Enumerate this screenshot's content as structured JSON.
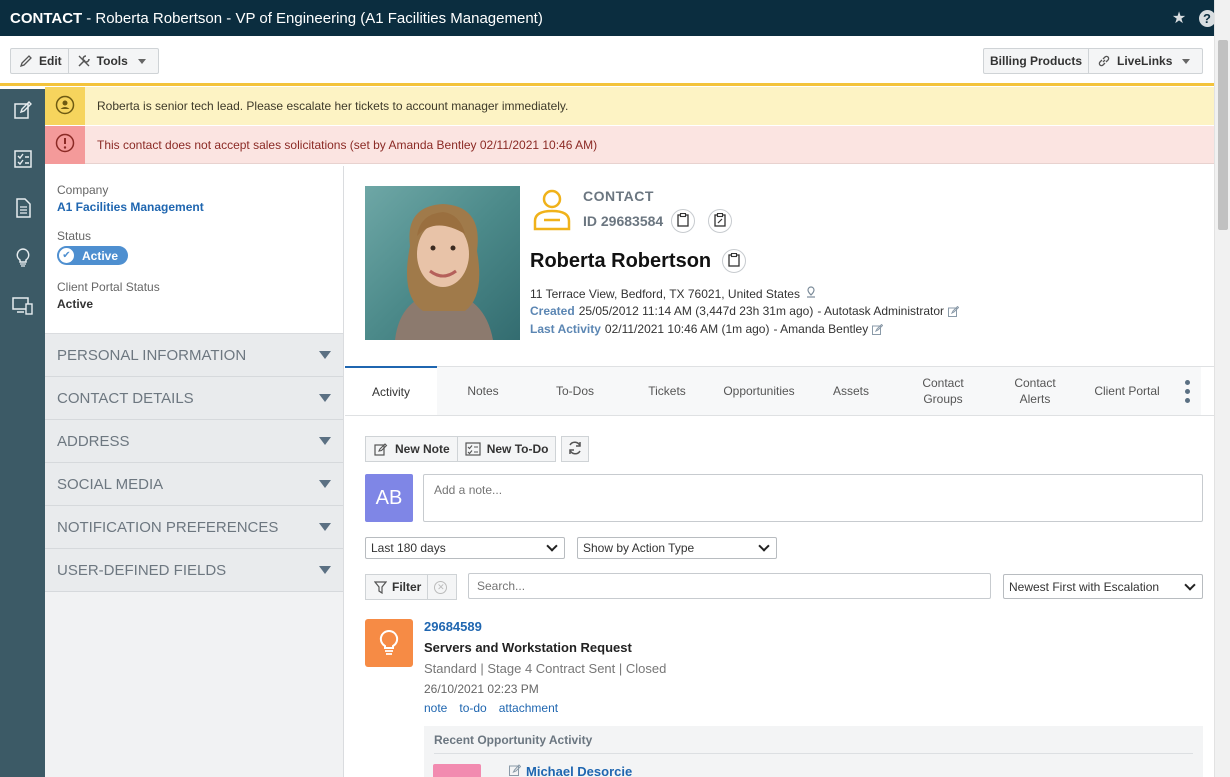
{
  "window": {
    "title_strong": "CONTACT",
    "title_rest": "- Roberta Robertson - VP of Engineering (A1 Facilities Management)"
  },
  "toolbar": {
    "edit_label": "Edit",
    "tools_label": "Tools",
    "billing_label": "Billing Products",
    "livelinks_label": "LiveLinks"
  },
  "alerts": {
    "yellow": "Roberta is senior tech lead. Please escalate her tickets to account manager immediately.",
    "red": "This contact does not accept sales solicitations (set by Amanda Bentley 02/11/2021 10:46 AM)"
  },
  "left_panel": {
    "company_label": "Company",
    "company_value": "A1 Facilities Management",
    "status_label": "Status",
    "status_value": "Active",
    "portal_label": "Client Portal Status",
    "portal_value": "Active",
    "sections": [
      "PERSONAL INFORMATION",
      "CONTACT DETAILS",
      "ADDRESS",
      "SOCIAL MEDIA",
      "NOTIFICATION PREFERENCES",
      "USER-DEFINED FIELDS"
    ]
  },
  "contact": {
    "type": "CONTACT",
    "id": "ID 29683584",
    "name": "Roberta Robertson",
    "address": "11 Terrace View, Bedford, TX 76021, United States",
    "created_label": "Created",
    "created_value": "25/05/2012 11:14 AM (3,447d 23h 31m ago)",
    "created_by": "- Autotask Administrator",
    "last_activity_label": "Last Activity",
    "last_activity_value": "02/11/2021 10:46 AM (1m ago)",
    "last_activity_by": "- Amanda Bentley"
  },
  "tabs": [
    {
      "label": "Activity",
      "line2": ""
    },
    {
      "label": "Notes",
      "line2": ""
    },
    {
      "label": "To-Dos",
      "line2": ""
    },
    {
      "label": "Tickets",
      "line2": ""
    },
    {
      "label": "Opportunities",
      "line2": ""
    },
    {
      "label": "Assets",
      "line2": ""
    },
    {
      "label": "Contact",
      "line2": "Groups"
    },
    {
      "label": "Contact",
      "line2": "Alerts"
    },
    {
      "label": "Client Portal",
      "line2": ""
    }
  ],
  "activity": {
    "new_note_label": "New Note",
    "new_todo_label": "New To-Do",
    "avatar_initials": "AB",
    "note_placeholder": "Add a note...",
    "range_value": "Last 180 days",
    "type_value": "Show by Action Type",
    "filter_label": "Filter",
    "search_placeholder": "Search...",
    "sort_value": "Newest First with Escalation"
  },
  "opportunity": {
    "id": "29684589",
    "title": "Servers and Workstation Request",
    "subtitle": "Standard | Stage 4 Contract Sent | Closed",
    "date": "26/10/2021 02:23 PM",
    "links": [
      "note",
      "to-do",
      "attachment"
    ],
    "recent_title": "Recent Opportunity Activity",
    "recent_name": "Michael Desorcie"
  },
  "colors": {
    "titlebar": "#0b2d3f",
    "accent_blue": "#1f66b0",
    "alert_yellow": "#fdf3c4",
    "alert_red": "#fbe4e1",
    "avatar": "#7f86e6",
    "opportunity": "#f68b45"
  }
}
